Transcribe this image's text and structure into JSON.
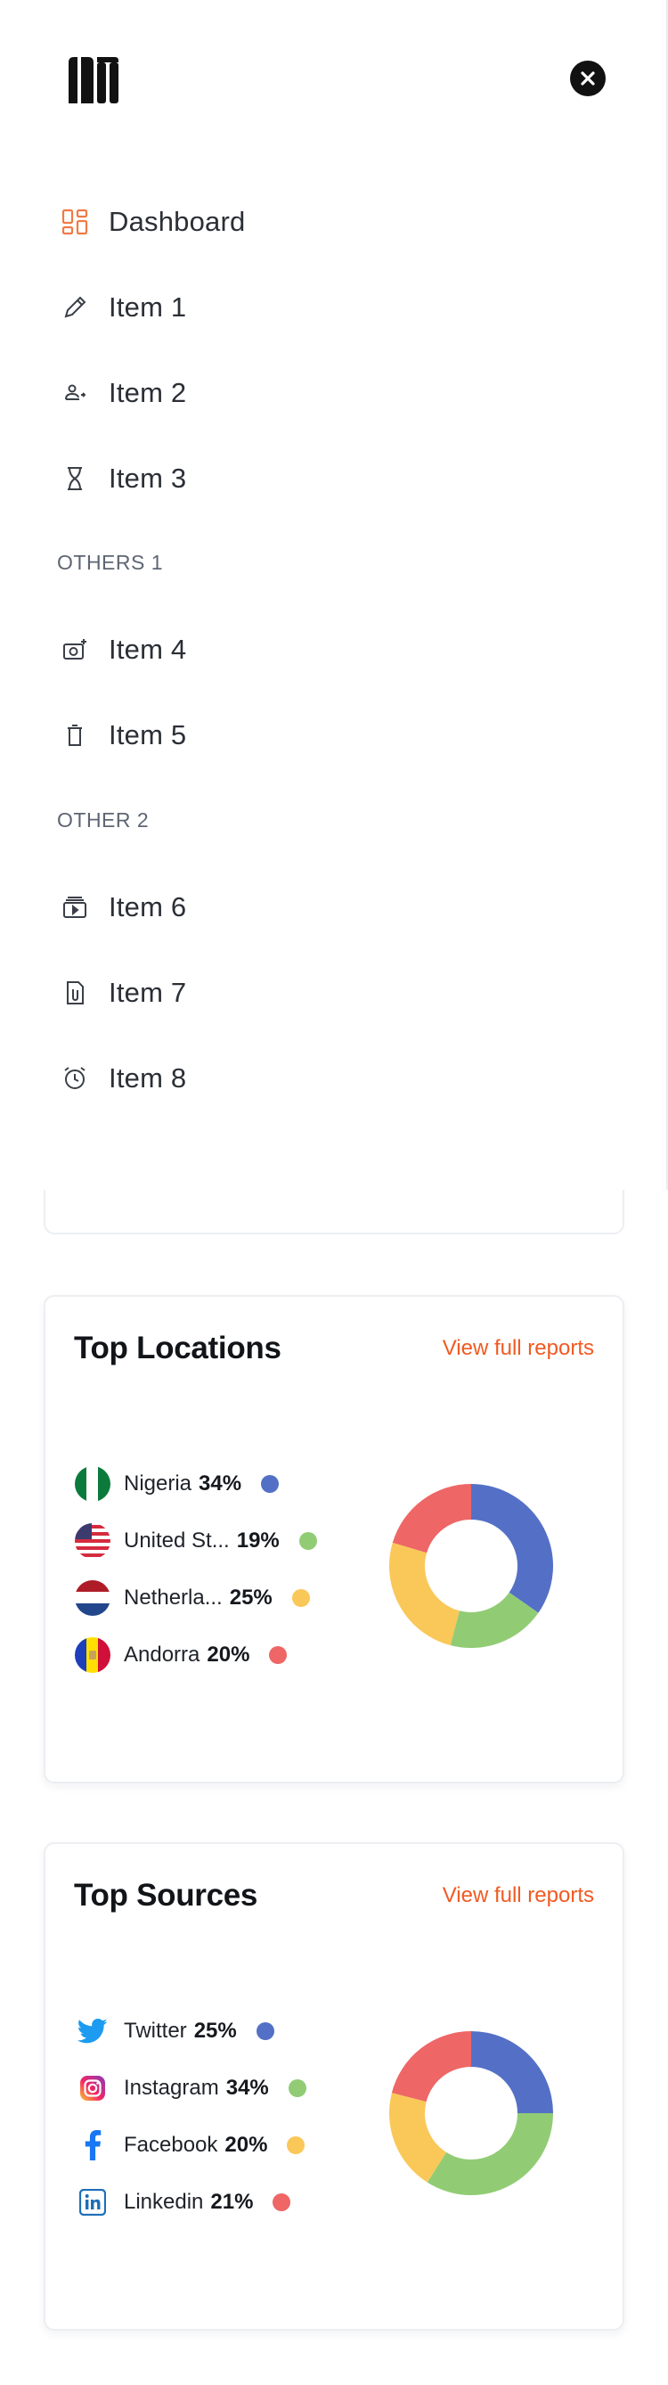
{
  "drawer": {
    "nav": [
      {
        "label": "Dashboard",
        "icon": "dashboard-icon",
        "active": true
      },
      {
        "label": "Item 1",
        "icon": "pencil-icon"
      },
      {
        "label": "Item 2",
        "icon": "users-icon"
      },
      {
        "label": "Item 3",
        "icon": "hourglass-icon"
      }
    ],
    "section_1": "OTHERS 1",
    "nav_2": [
      {
        "label": "Item 4",
        "icon": "camera-plus-icon"
      },
      {
        "label": "Item 5",
        "icon": "trash-icon"
      }
    ],
    "section_2": "OTHER 2",
    "nav_3": [
      {
        "label": "Item 6",
        "icon": "video-play-icon"
      },
      {
        "label": "Item 7",
        "icon": "attachment-file-icon"
      },
      {
        "label": "Item 8",
        "icon": "alarm-clock-icon"
      }
    ]
  },
  "top_locations": {
    "title": "Top Locations",
    "link": "View full reports",
    "rows": [
      {
        "name": "Nigeria",
        "pct": "34%",
        "icon": "nigeria-flag-icon"
      },
      {
        "name": "United St...",
        "pct": "19%",
        "icon": "usa-flag-icon"
      },
      {
        "name": "Netherla...",
        "pct": "25%",
        "icon": "netherlands-flag-icon"
      },
      {
        "name": "Andorra",
        "pct": "20%",
        "icon": "andorra-flag-icon"
      }
    ]
  },
  "top_sources": {
    "title": "Top Sources",
    "link": "View full reports",
    "rows": [
      {
        "name": "Twitter",
        "pct": "25%",
        "icon": "twitter-icon"
      },
      {
        "name": "Instagram",
        "pct": "34%",
        "icon": "instagram-icon"
      },
      {
        "name": "Facebook",
        "pct": "20%",
        "icon": "facebook-icon"
      },
      {
        "name": "Linkedin",
        "pct": "21%",
        "icon": "linkedin-icon"
      }
    ]
  },
  "colors": {
    "accent": "#f05a22",
    "blue": "#5470c6",
    "green": "#91cc75",
    "yellow": "#fac858",
    "red": "#ee6666"
  },
  "chart_data": [
    {
      "type": "pie",
      "categories": [
        "Nigeria",
        "United St...",
        "Netherla...",
        "Andorra"
      ],
      "values": [
        34,
        19,
        25,
        20
      ],
      "colors": [
        "#5470c6",
        "#91cc75",
        "#fac858",
        "#ee6666"
      ],
      "title": "Top Locations"
    },
    {
      "type": "pie",
      "categories": [
        "Twitter",
        "Instagram",
        "Facebook",
        "Linkedin"
      ],
      "values": [
        25,
        34,
        20,
        21
      ],
      "colors": [
        "#5470c6",
        "#91cc75",
        "#fac858",
        "#ee6666"
      ],
      "title": "Top Sources"
    }
  ]
}
